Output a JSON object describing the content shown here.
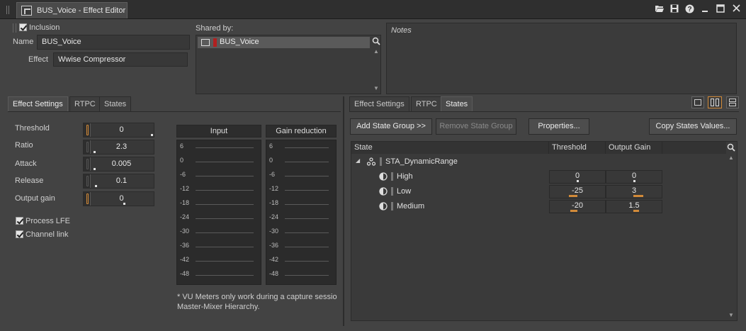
{
  "window": {
    "title": "BUS_Voice - Effect Editor"
  },
  "general": {
    "inclusion_label": "Inclusion",
    "name_label": "Name",
    "name_value": "BUS_Voice",
    "effect_label": "Effect",
    "effect_value": "Wwise Compressor",
    "shared_by_label": "Shared by:",
    "shared_by_item": "BUS_Voice",
    "notes_placeholder": "Notes"
  },
  "left_tabs": [
    "Effect Settings",
    "RTPC",
    "States"
  ],
  "params": [
    {
      "label": "Threshold",
      "value": "0"
    },
    {
      "label": "Ratio",
      "value": "2.3"
    },
    {
      "label": "Attack",
      "value": "0.005"
    },
    {
      "label": "Release",
      "value": "0.1"
    },
    {
      "label": "Output gain",
      "value": "0"
    }
  ],
  "options": {
    "process_lfe": "Process LFE",
    "channel_link": "Channel link"
  },
  "meters": {
    "input_label": "Input",
    "gain_reduction_label": "Gain reduction",
    "scale": [
      "6",
      "0",
      "-6",
      "-12",
      "-18",
      "-24",
      "-30",
      "-36",
      "-42",
      "-48"
    ],
    "note_line1": "* VU Meters only work during a capture session",
    "note_line2": "Master-Mixer Hierarchy."
  },
  "right_tabs": [
    "Effect Settings",
    "RTPC",
    "States"
  ],
  "states_toolbar": {
    "add_state_group": "Add State Group >>",
    "remove_state_group": "Remove State Group",
    "properties": "Properties...",
    "copy_states_values": "Copy States Values..."
  },
  "states_table": {
    "columns": [
      "State",
      "Threshold",
      "Output Gain"
    ],
    "group": "STA_DynamicRange",
    "rows": [
      {
        "name": "High",
        "threshold": "0",
        "output_gain": "0"
      },
      {
        "name": "Low",
        "threshold": "-25",
        "output_gain": "3"
      },
      {
        "name": "Medium",
        "threshold": "-20",
        "output_gain": "1.5"
      }
    ]
  },
  "colors": {
    "accent_orange": "#d18a39",
    "shared_marker": "#b02020"
  }
}
